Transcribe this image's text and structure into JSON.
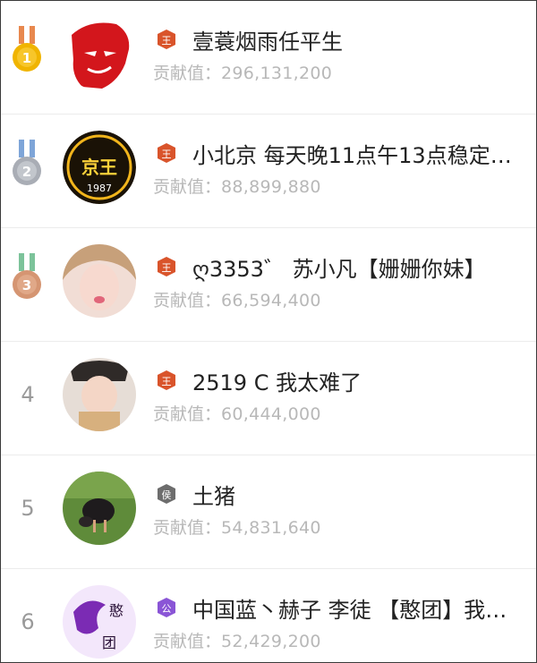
{
  "contribution_label": "贡献值：",
  "rows": [
    {
      "rank": "1",
      "name": "壹蓑烟雨任平生",
      "contribution": "296,131,200",
      "badge_text": "王",
      "medal": "gold",
      "avatar": "che-portrait",
      "badge_color": "#d9542b"
    },
    {
      "rank": "2",
      "name": "小北京 每天晚11点午13点稳定…",
      "contribution": "88,899,880",
      "badge_text": "王",
      "medal": "silver",
      "avatar": "beijing-king-1987",
      "badge_color": "#d9542b",
      "avatar_text": [
        "京王",
        "1987"
      ]
    },
    {
      "rank": "3",
      "name": "ღ3353゛ 苏小凡【姗姗你妹】",
      "contribution": "66,594,400",
      "badge_text": "王",
      "medal": "bronze",
      "avatar": "girl-selfie",
      "badge_color": "#d9542b"
    },
    {
      "rank": "4",
      "name": "2519 C 我太难了",
      "contribution": "60,444,000",
      "badge_text": "王",
      "medal": "none",
      "avatar": "baby-photo",
      "badge_color": "#d9542b"
    },
    {
      "rank": "5",
      "name": "土猪",
      "contribution": "54,831,640",
      "badge_text": "侯",
      "medal": "none",
      "avatar": "pig-on-grass",
      "badge_color": "#6d6d6d"
    },
    {
      "rank": "6",
      "name": "中国蓝丶赫子 李徒 【憨团】我…",
      "contribution": "52,429,200",
      "badge_text": "公",
      "medal": "none",
      "avatar": "han-tuan-logo",
      "badge_color": "#8a55d6",
      "avatar_text": [
        "憨",
        "团"
      ]
    }
  ]
}
